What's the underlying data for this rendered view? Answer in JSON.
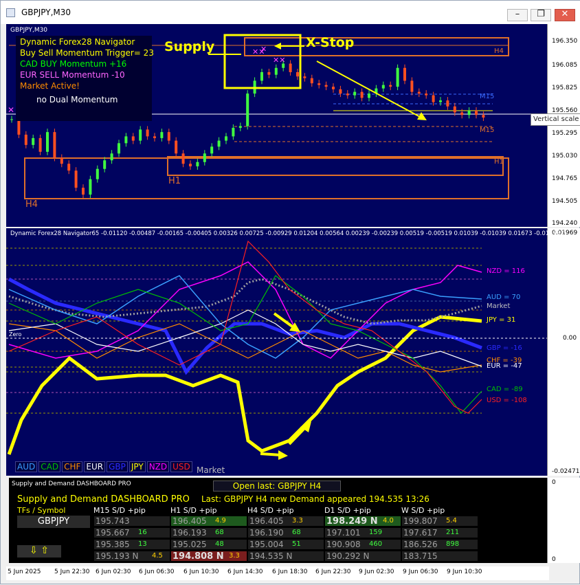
{
  "window": {
    "title": "GBPJPY,M30"
  },
  "main_chart": {
    "symbol_label": "GBPJPY,M30",
    "price_scale": [
      "196.350",
      "196.085",
      "195.825",
      "195.560",
      "195.295",
      "195.030",
      "194.765",
      "194.505",
      "194.240"
    ],
    "info_lines": [
      "Dynamic Forex28 Navigator",
      "Buy Sell Momentum Trigger= 23",
      "CAD BUY Momentum +16",
      "EUR SELL Momentum -10",
      "Market Active!",
      "no Dual Momentum"
    ],
    "info_colors": [
      "#ffff00",
      "#ffff00",
      "#00ff00",
      "#ff66ff",
      "#ff8c00",
      "#ffffff"
    ],
    "zone_labels": {
      "h4_top": "H4",
      "h4_left": "H4",
      "h1": "H1",
      "h1_right": "H1",
      "m15_top": "M15",
      "m15_bottom": "M15"
    },
    "annotations": {
      "supply": "Supply",
      "xstop": "X-Stop"
    },
    "tooltip": "Vertical scale"
  },
  "indicator": {
    "header": "Dynamic Forex28 Navigator65 -0.01120 -0.00487 -0.00165 -0.00405 0.00326 0.00725 -0.00929 0.01204 0.00564 0.00239 -0.00239 0.00519 -0.00519 0.01039 -0.01039 0.01673 -0.01673 0",
    "scale_top": "0.01969",
    "scale_mid": "0.00",
    "scale_bottom": "-0.02471",
    "zero_label": "Zero",
    "currency_labels": [
      {
        "text": "NZD = 116",
        "color": "#ff00ff"
      },
      {
        "text": "AUD = 70",
        "color": "#3aa0ff"
      },
      {
        "text": "Market",
        "color": "#c0c0c0"
      },
      {
        "text": "JPY = 31",
        "color": "#ffff00"
      },
      {
        "text": "GBP = -16",
        "color": "#2a2aff"
      },
      {
        "text": "CHF = -39",
        "color": "#ff8c00"
      },
      {
        "text": "EUR = -47",
        "color": "#ffffff"
      },
      {
        "text": "CAD = -89",
        "color": "#00c000"
      },
      {
        "text": "USD = -108",
        "color": "#ff2020"
      }
    ],
    "legend": [
      {
        "text": "AUD",
        "color": "#3aa0ff"
      },
      {
        "text": "CAD",
        "color": "#00c000"
      },
      {
        "text": "CHF",
        "color": "#ff8c00"
      },
      {
        "text": "EUR",
        "color": "#ffffff"
      },
      {
        "text": "GBP",
        "color": "#2a2aff"
      },
      {
        "text": "JPY",
        "color": "#ffff00"
      },
      {
        "text": "NZD",
        "color": "#ff00ff"
      },
      {
        "text": "USD",
        "color": "#ff2020"
      }
    ],
    "market_label": "Market"
  },
  "dashboard": {
    "header": "Supply and Demand DASHBOARD PRO",
    "open_last": "Open last: GBPJPY H4",
    "title": "Supply and Demand DASHBOARD PRO",
    "last": "Last: GBPJPY H4 new Demand appeared 194.535 13:26",
    "col_headers": [
      "TFs / Symbol",
      "M15 S/D +pip",
      "H1 S/D +pip",
      "H4 S/D +pip",
      "D1 S/D +pip",
      "W S/D +pip"
    ],
    "symbol": "GBPJPY",
    "arrows": "⇩ ⇧",
    "rows": [
      [
        {
          "v": "195.743",
          "p": ""
        },
        {
          "v": "196.405",
          "p": "4.9",
          "hl": "green"
        },
        {
          "v": "196.405",
          "p": "3.3"
        },
        {
          "v": "198.249 N",
          "p": "4.0",
          "hl": "green",
          "big": true
        },
        {
          "v": "199.807",
          "p": "5.4"
        }
      ],
      [
        {
          "v": "195.667",
          "p": "16"
        },
        {
          "v": "196.193",
          "p": "68"
        },
        {
          "v": "196.190",
          "p": "68"
        },
        {
          "v": "197.101",
          "p": "159"
        },
        {
          "v": "197.617",
          "p": "211"
        }
      ],
      [
        {
          "v": "195.385",
          "p": "13"
        },
        {
          "v": "195.025",
          "p": "48"
        },
        {
          "v": "195.004",
          "p": "51"
        },
        {
          "v": "190.908",
          "p": "460"
        },
        {
          "v": "186.526",
          "p": "898"
        }
      ],
      [
        {
          "v": "195.193 N",
          "p": "4.5"
        },
        {
          "v": "194.808 N",
          "p": "3.3",
          "hl": "red",
          "big": true
        },
        {
          "v": "194.535 N",
          "p": ""
        },
        {
          "v": "190.292 N",
          "p": ""
        },
        {
          "v": "183.715",
          "p": ""
        }
      ]
    ],
    "scale_top": "0",
    "scale_bottom": "0"
  },
  "x_axis": [
    "5 Jun 2025",
    "5 Jun 22:30",
    "6 Jun 02:30",
    "6 Jun 06:30",
    "6 Jun 10:30",
    "6 Jun 14:30",
    "6 Jun 18:30",
    "6 Jun 22:30",
    "9 Jun 02:30",
    "9 Jun 06:30",
    "9 Jun 10:30"
  ]
}
